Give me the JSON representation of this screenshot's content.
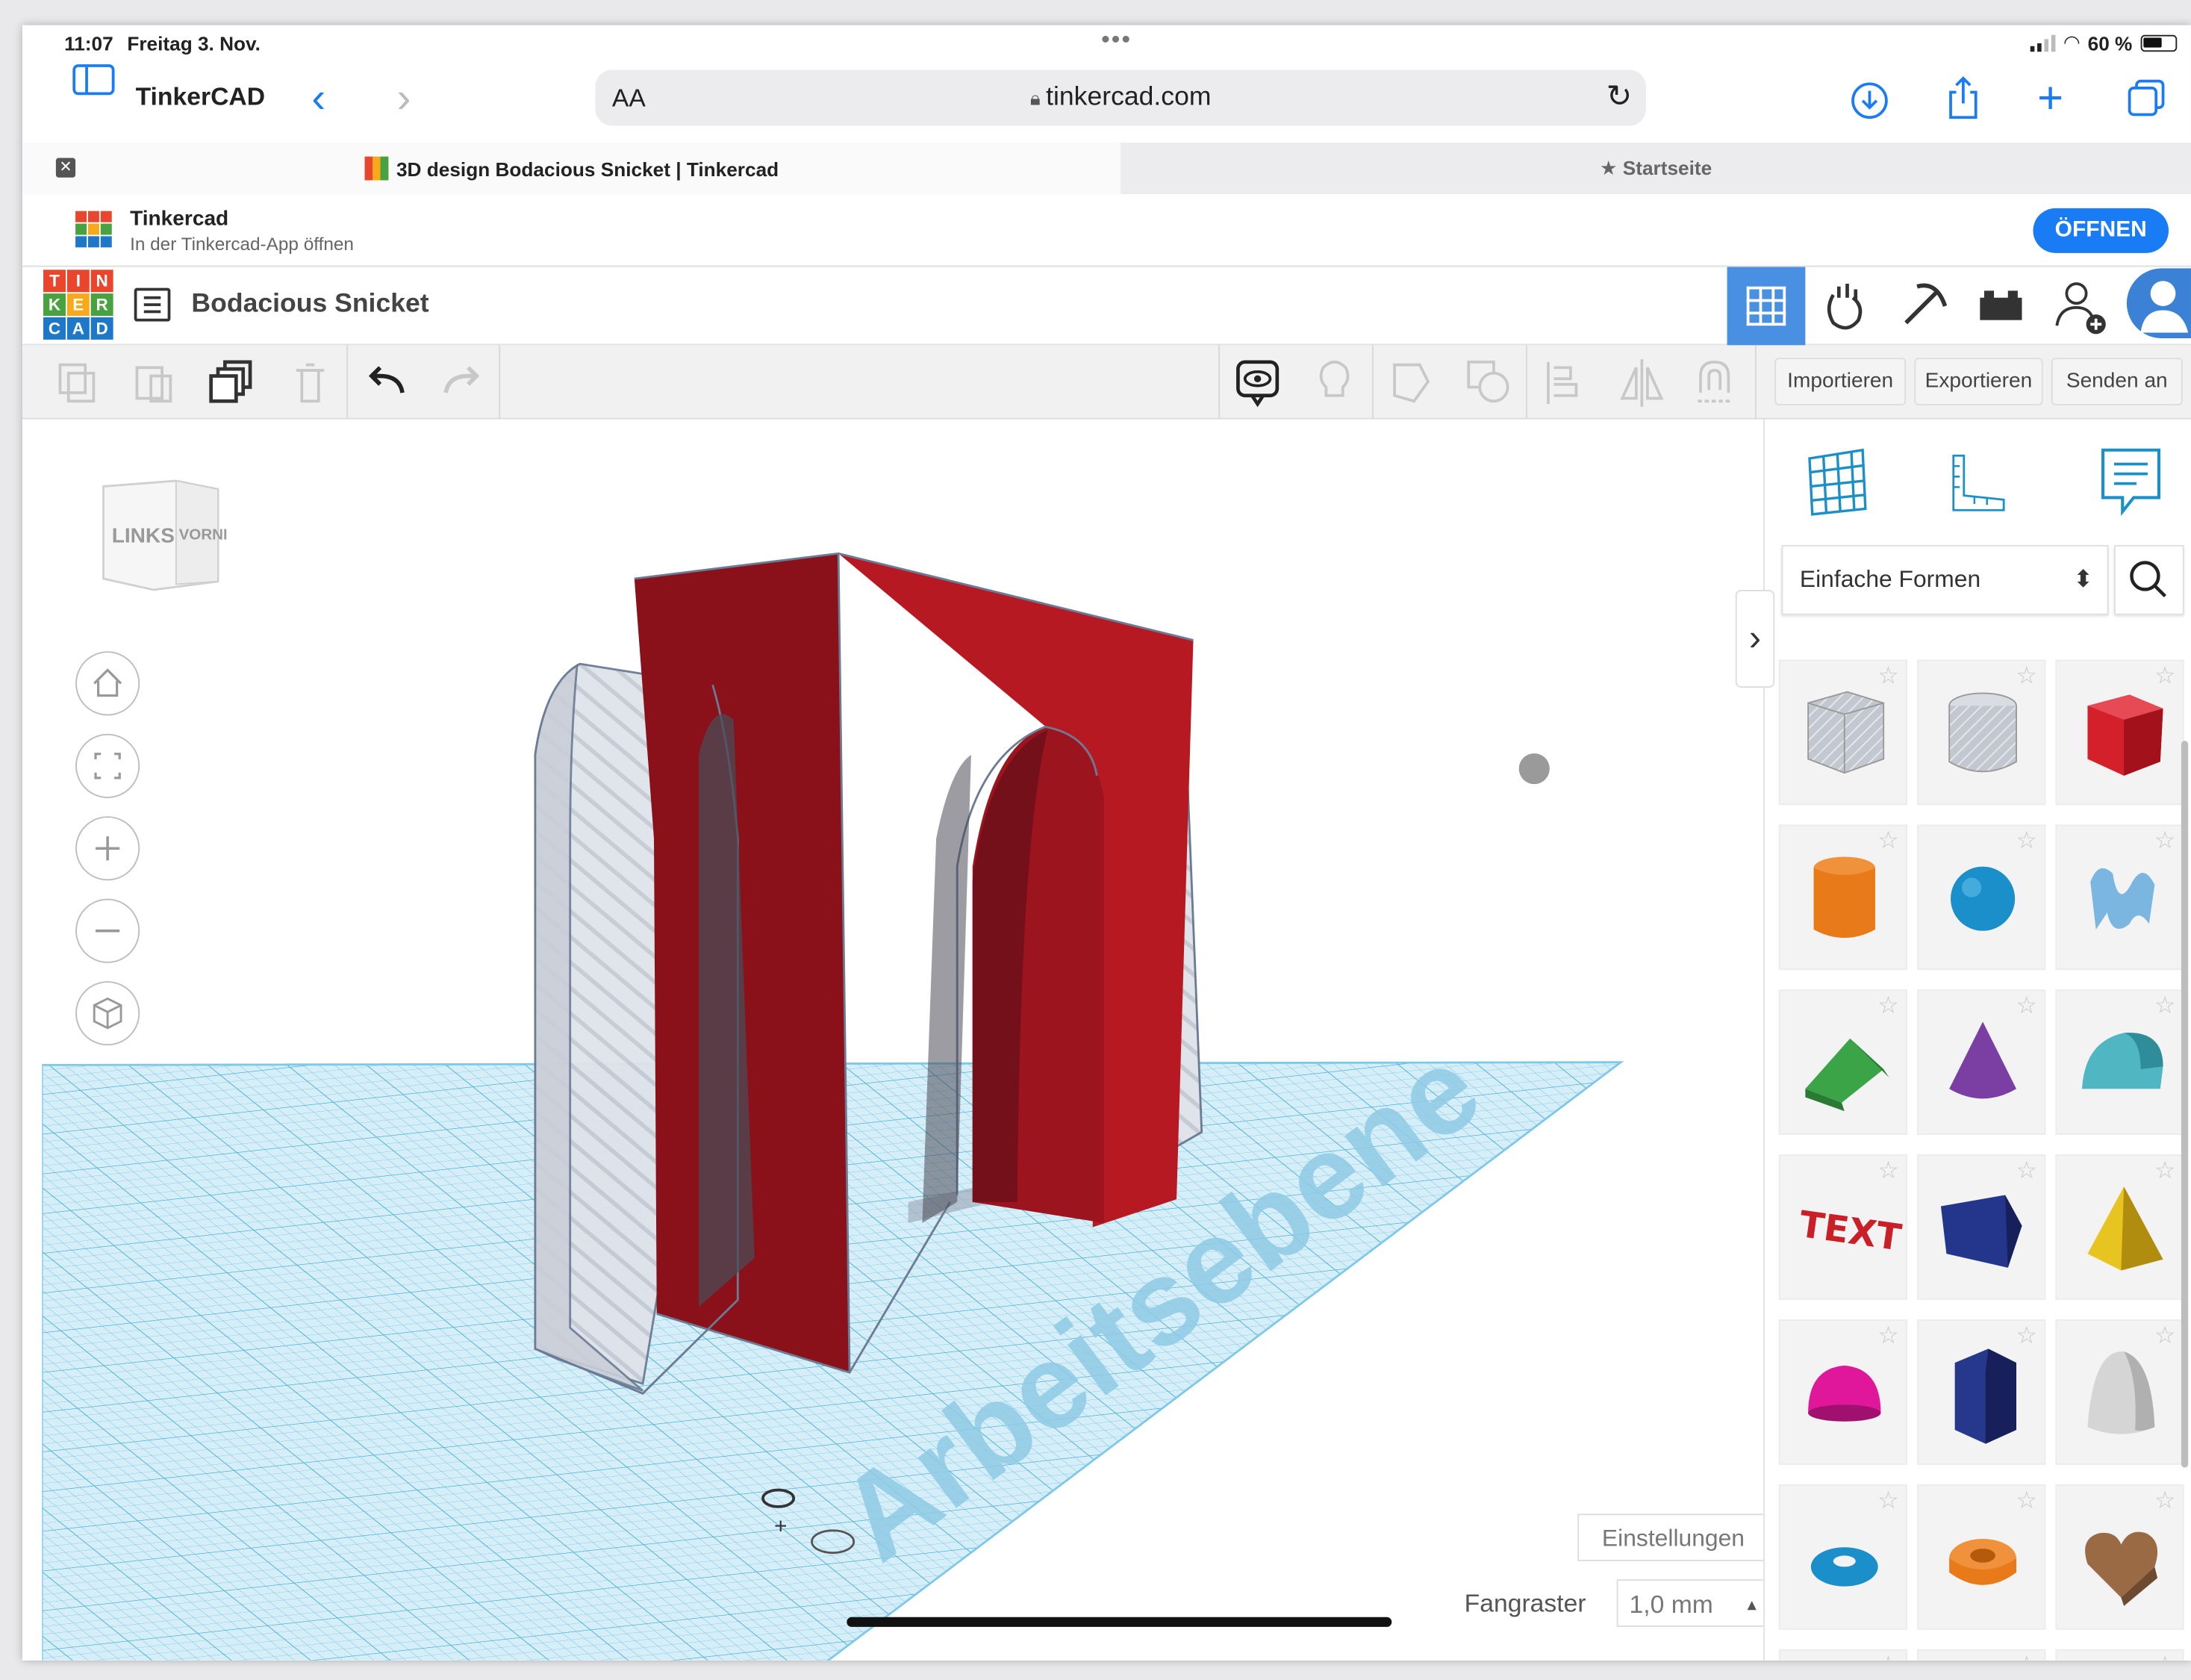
{
  "status_bar": {
    "time": "11:07",
    "date": "Freitag 3. Nov.",
    "battery": "60 %"
  },
  "browser": {
    "app_name": "TinkerCAD",
    "text_size": "AA",
    "url": "tinkercad.com",
    "tabs": [
      {
        "title": "3D design Bodacious Snicket | Tinkercad",
        "active": true
      },
      {
        "title": "Startseite",
        "active": false
      }
    ]
  },
  "app_banner": {
    "name": "Tinkercad",
    "subtitle": "In der Tinkercad-App öffnen",
    "open_label": "ÖFFNEN"
  },
  "app": {
    "logo_letters": [
      "T",
      "I",
      "N",
      "K",
      "E",
      "R",
      "C",
      "A",
      "D"
    ],
    "design_name": "Bodacious Snicket",
    "toolbar": {
      "import_label": "Importieren",
      "export_label": "Exportieren",
      "send_label": "Senden an"
    }
  },
  "viewport": {
    "viewcube_left": "LINKS",
    "viewcube_front": "VORNE",
    "workplane_label": "Arbeitsebene",
    "settings_label": "Einstellungen",
    "snap_label": "Fangraster",
    "snap_value": "1,0 mm"
  },
  "shapes_panel": {
    "category": "Einfache Formen",
    "shapes": [
      {
        "name": "Box (Hole)",
        "color": "#b8bcc4"
      },
      {
        "name": "Cylinder (Hole)",
        "color": "#b8bcc4"
      },
      {
        "name": "Box",
        "color": "#d4202b"
      },
      {
        "name": "Cylinder",
        "color": "#e97a1a"
      },
      {
        "name": "Sphere",
        "color": "#1a8fc9"
      },
      {
        "name": "Scribble",
        "color": "#7ab6e0"
      },
      {
        "name": "Roof",
        "color": "#3aa447"
      },
      {
        "name": "Cone",
        "color": "#7b3fa4"
      },
      {
        "name": "Round Roof",
        "color": "#4fb6c2"
      },
      {
        "name": "Text",
        "color": "#c91f27"
      },
      {
        "name": "Wedge",
        "color": "#24368c"
      },
      {
        "name": "Pyramid",
        "color": "#e8c420"
      },
      {
        "name": "Half Sphere",
        "color": "#e0179b"
      },
      {
        "name": "Polygon",
        "color": "#26388c"
      },
      {
        "name": "Paraboloid",
        "color": "#d5d5d5"
      },
      {
        "name": "Torus",
        "color": "#1a8fc9"
      },
      {
        "name": "Tube",
        "color": "#e97a1a"
      },
      {
        "name": "Heart",
        "color": "#9a6a45"
      }
    ]
  }
}
